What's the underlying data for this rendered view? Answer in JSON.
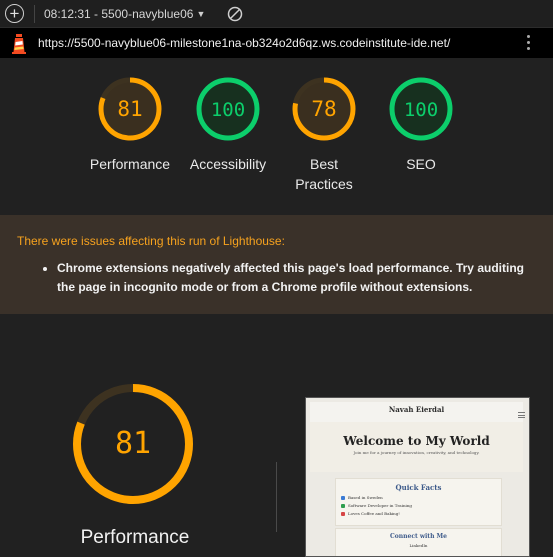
{
  "topbar": {
    "report_selector": "08:12:31 - 5500-navyblue06",
    "new_report_icon": "plus-circle-icon",
    "clear_icon": "block-icon"
  },
  "urlbar": {
    "url": "https://5500-navyblue06-milestone1na-ob324o2d6qz.ws.codeinstitute-ide.net/",
    "logo_icon": "lighthouse-icon",
    "menu_icon": "kebab-menu-icon"
  },
  "scores": [
    {
      "label": "Performance",
      "value": "81",
      "fraction": 0.81,
      "color": "#ffa400",
      "track": "#3d3220",
      "fill": "#3a2f1f"
    },
    {
      "label": "Accessibility",
      "value": "100",
      "fraction": 1.0,
      "color": "#0cce6b",
      "track": "#173b29",
      "fill": "#17301f"
    },
    {
      "label": "Best Practices",
      "value": "78",
      "fraction": 0.78,
      "color": "#ffa400",
      "track": "#3d3220",
      "fill": "#3a2f1f"
    },
    {
      "label": "SEO",
      "value": "100",
      "fraction": 1.0,
      "color": "#0cce6b",
      "track": "#173b29",
      "fill": "#17301f"
    }
  ],
  "warning": {
    "title": "There were issues affecting this run of Lighthouse:",
    "items": [
      "Chrome extensions negatively affected this page's load performance. Try auditing the page in incognito mode or from a Chrome profile without extensions."
    ]
  },
  "detail": {
    "label": "Performance",
    "value": "81",
    "fraction": 0.81,
    "color": "#ffa400"
  },
  "screenshot": {
    "site_name": "Navah Eierdal",
    "hero_title": "Welcome to My World",
    "hero_subtitle": "Join me for a journey of innovation, creativity, and technology.",
    "facts_title": "Quick Facts",
    "facts": [
      {
        "text": "Based in Sweden",
        "color": "#3a7bd5"
      },
      {
        "text": "Software Developer in Training",
        "color": "#2e9e4f"
      },
      {
        "text": "Loves Coffee and Baking!",
        "color": "#d64545"
      }
    ],
    "connect_title": "Connect with Me",
    "connect_item": "LinkedIn"
  }
}
